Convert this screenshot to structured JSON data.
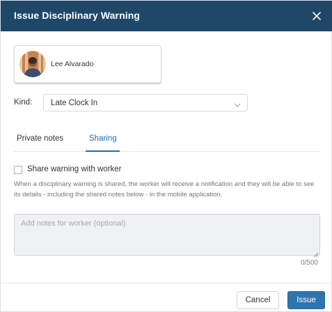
{
  "dialog": {
    "title": "Issue Disciplinary Warning",
    "close_icon": "close-icon"
  },
  "worker": {
    "name": "Lee Alvarado",
    "avatar_icon": "user-avatar"
  },
  "kind": {
    "label": "Kind:",
    "value": "Late Clock In",
    "dropdown_icon": "chevron-down-icon"
  },
  "tabs": [
    {
      "label": "Private notes",
      "active": false
    },
    {
      "label": "Sharing",
      "active": true
    }
  ],
  "sharing": {
    "checkbox_label": "Share warning with worker",
    "checked": false,
    "description": "When a disciplinary warning is shared, the worker will receive a notification and they will be able to see its details - including the shared notes below - in the mobile application.",
    "notes_placeholder": "Add notes for worker (optional)",
    "notes_value": "",
    "char_count": "0/500"
  },
  "footer": {
    "cancel_label": "Cancel",
    "issue_label": "Issue"
  },
  "colors": {
    "header_bg": "#1f4768",
    "accent": "#1f6fa8",
    "primary_button": "#2f74ad"
  }
}
